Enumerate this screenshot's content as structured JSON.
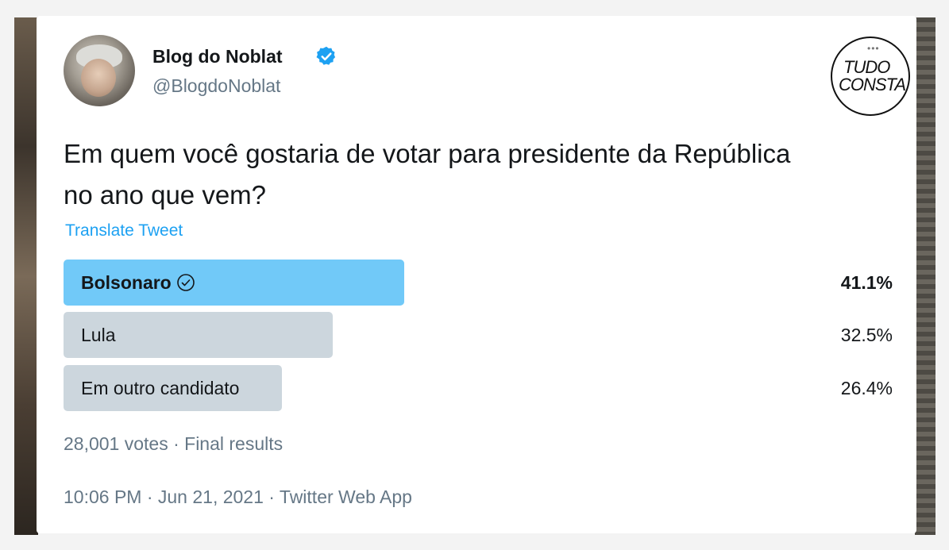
{
  "author": {
    "display_name": "Blog do Noblat",
    "handle": "@BlogdoNoblat",
    "verified": true
  },
  "brand_logo": {
    "line1": "TUDO",
    "line2": "CONSTA"
  },
  "tweet": {
    "text": "Em quem você gostaria de votar para presidente da República no ano que vem?",
    "translate_label": "Translate Tweet"
  },
  "poll": {
    "options": [
      {
        "label": "Bolsonaro",
        "percent_text": "41.1%",
        "percent": 41.1,
        "winner": true,
        "bar_color": "#71c9f8"
      },
      {
        "label": "Lula",
        "percent_text": "32.5%",
        "percent": 32.5,
        "winner": false,
        "bar_color": "#ccd6dd"
      },
      {
        "label": "Em outro candidato",
        "percent_text": "26.4%",
        "percent": 26.4,
        "winner": false,
        "bar_color": "#ccd6dd"
      }
    ],
    "summary": "28,001 votes · Final results"
  },
  "meta": {
    "timestamp": "10:06 PM · Jun 21, 2021 · Twitter Web App"
  },
  "colors": {
    "link": "#1da1f2",
    "secondary_text": "#657786",
    "winner_bar": "#71c9f8",
    "other_bar": "#ccd6dd"
  }
}
